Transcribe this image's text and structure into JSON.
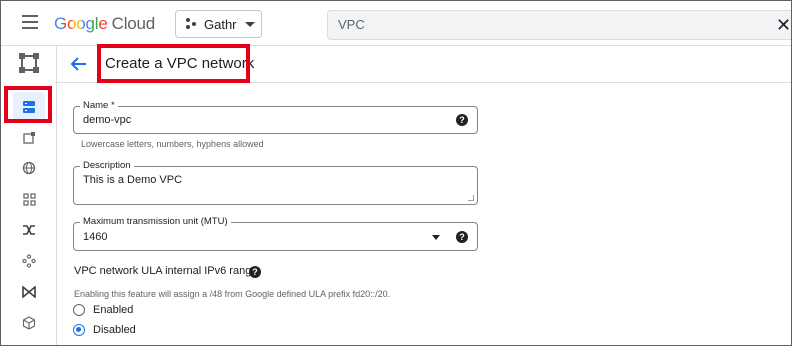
{
  "topbar": {
    "logo": {
      "google": "Google",
      "cloud": "Cloud"
    },
    "project_label": "Gathr",
    "search_value": "VPC"
  },
  "rail": {
    "items": [
      {
        "icon": "network-icon"
      },
      {
        "icon": "vpc-networks-icon",
        "active": true
      },
      {
        "icon": "ip-addresses-icon"
      },
      {
        "icon": "globe-icon"
      },
      {
        "icon": "grid-icon"
      },
      {
        "icon": "shuffle-icon"
      },
      {
        "icon": "routes-icon"
      },
      {
        "icon": "bowtie-icon"
      },
      {
        "icon": "cube-icon"
      }
    ]
  },
  "header": {
    "title": "Create a VPC network"
  },
  "form": {
    "name": {
      "label": "Name *",
      "value": "demo-vpc",
      "hint": "Lowercase letters, numbers, hyphens allowed"
    },
    "description": {
      "label": "Description",
      "value": "This is a Demo VPC"
    },
    "mtu": {
      "label": "Maximum transmission unit (MTU)",
      "value": "1460"
    },
    "ipv6": {
      "title": "VPC network ULA internal IPv6 range",
      "hint": "Enabling this feature will assign a /48 from Google defined ULA prefix fd20::/20.",
      "options": [
        {
          "label": "Enabled",
          "selected": false
        },
        {
          "label": "Disabled",
          "selected": true
        }
      ]
    }
  },
  "colors": {
    "accent": "#1a73e8",
    "highlight": "#e3001b",
    "active_bg": "#e8f0fe"
  }
}
